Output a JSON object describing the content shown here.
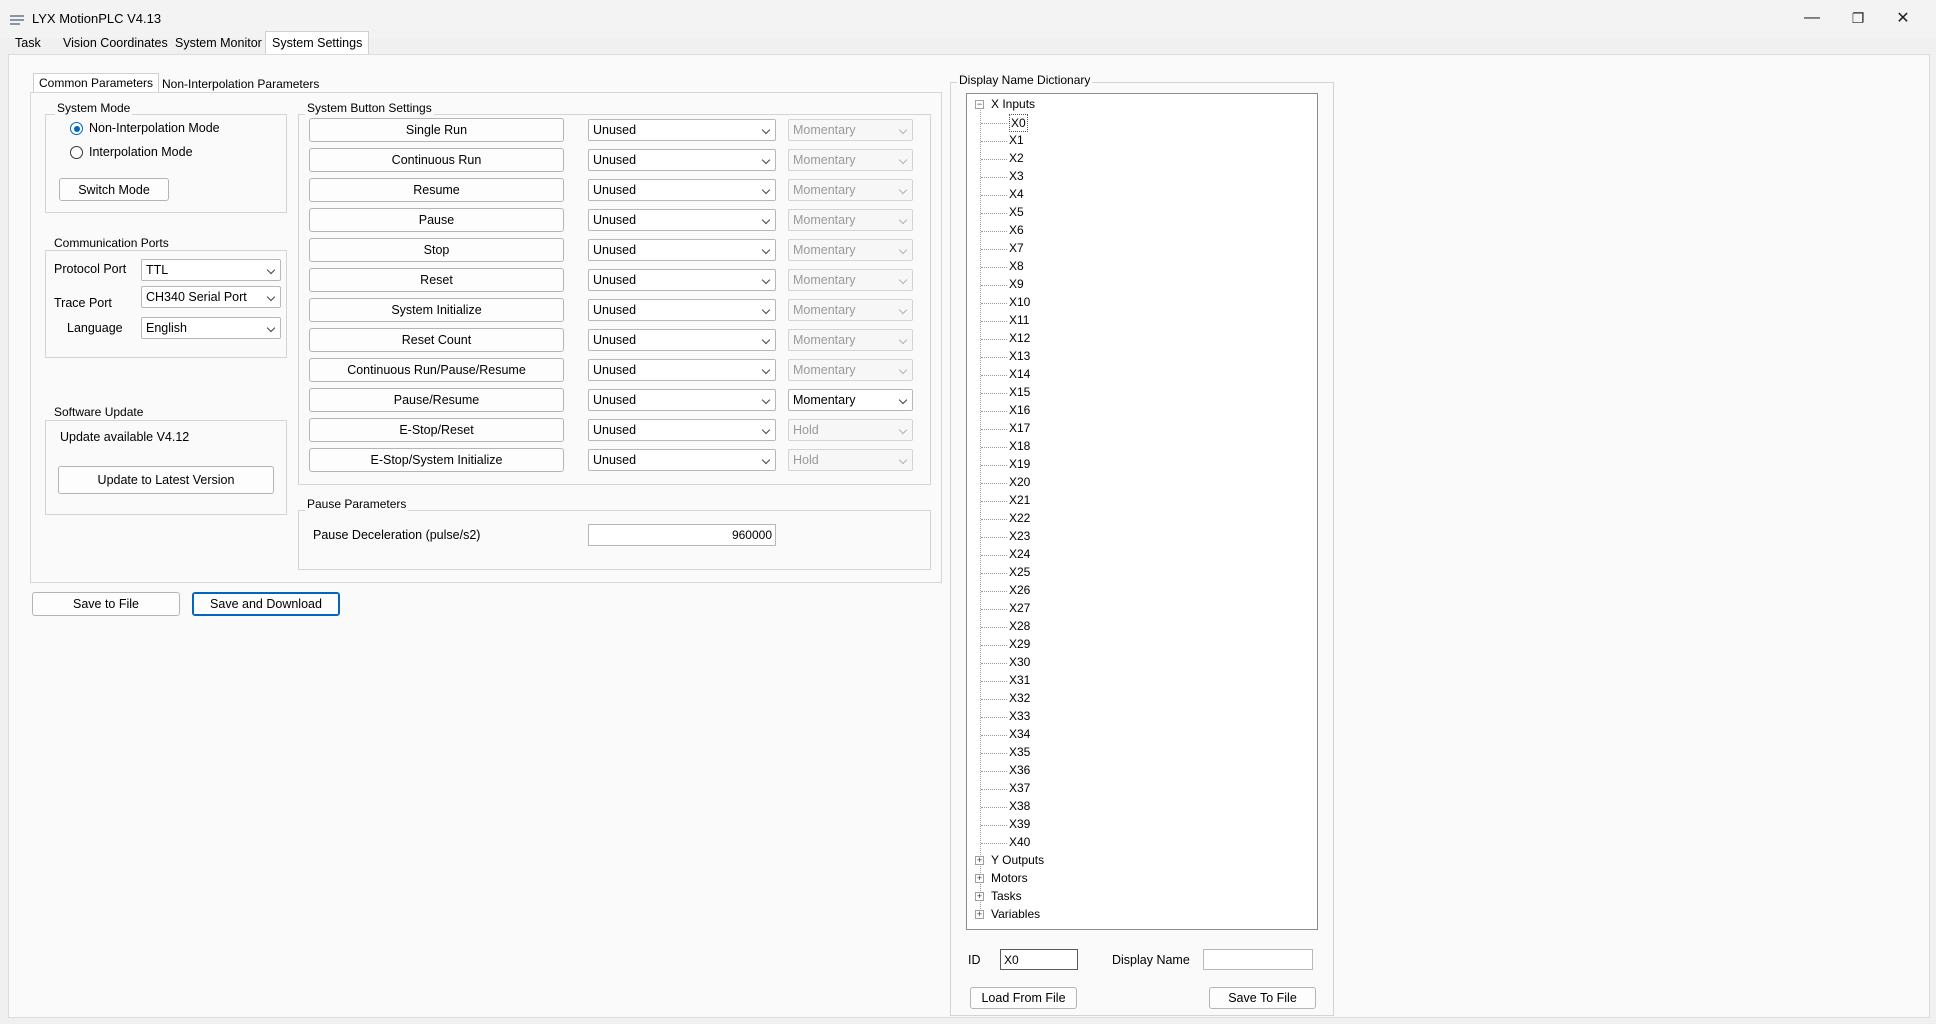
{
  "window": {
    "title": "LYX MotionPLC V4.13",
    "controls": [
      "—",
      "❐",
      "✕"
    ]
  },
  "main_tabs": [
    "Task",
    "Vision Coordinates",
    "System Monitor",
    "System Settings"
  ],
  "sub_tabs": [
    "Common Parameters",
    "Non-Interpolation Parameters"
  ],
  "system_mode": {
    "label": "System Mode",
    "options": [
      "Non-Interpolation Mode",
      "Interpolation Mode"
    ],
    "selected": "Non-Interpolation Mode",
    "switch_label": "Switch Mode"
  },
  "comm": {
    "label": "Communication Ports",
    "rows": [
      {
        "label": "Protocol Port",
        "value": "TTL"
      },
      {
        "label": "Trace Port",
        "value": "CH340 Serial Port"
      },
      {
        "label": "Language",
        "value": "English"
      }
    ]
  },
  "software_update": {
    "label": "Software Update",
    "status": "Update available V4.12",
    "button": "Update to Latest Version"
  },
  "system_buttons": {
    "label": "System Button Settings",
    "rows": [
      {
        "name": "Single Run",
        "assign": "Unused",
        "mode": "Momentary",
        "mode_enabled": false
      },
      {
        "name": "Continuous Run",
        "assign": "Unused",
        "mode": "Momentary",
        "mode_enabled": false
      },
      {
        "name": "Resume",
        "assign": "Unused",
        "mode": "Momentary",
        "mode_enabled": false
      },
      {
        "name": "Pause",
        "assign": "Unused",
        "mode": "Momentary",
        "mode_enabled": false
      },
      {
        "name": "Stop",
        "assign": "Unused",
        "mode": "Momentary",
        "mode_enabled": false
      },
      {
        "name": "Reset",
        "assign": "Unused",
        "mode": "Momentary",
        "mode_enabled": false
      },
      {
        "name": "System Initialize",
        "assign": "Unused",
        "mode": "Momentary",
        "mode_enabled": false
      },
      {
        "name": "Reset Count",
        "assign": "Unused",
        "mode": "Momentary",
        "mode_enabled": false
      },
      {
        "name": "Continuous Run/Pause/Resume",
        "assign": "Unused",
        "mode": "Momentary",
        "mode_enabled": false
      },
      {
        "name": "Pause/Resume",
        "assign": "Unused",
        "mode": "Momentary",
        "mode_enabled": true
      },
      {
        "name": "E-Stop/Reset",
        "assign": "Unused",
        "mode": "Hold",
        "mode_enabled": false
      },
      {
        "name": "E-Stop/System Initialize",
        "assign": "Unused",
        "mode": "Hold",
        "mode_enabled": false
      }
    ]
  },
  "pause_params": {
    "label": "Pause Parameters",
    "decel_label": "Pause Deceleration (pulse/s2)",
    "decel_value": "960000"
  },
  "actions": {
    "save_file": "Save to File",
    "save_download": "Save and Download"
  },
  "dictionary": {
    "label": "Display Name Dictionary",
    "root_expanded": "X Inputs",
    "x_items": [
      "X0",
      "X1",
      "X2",
      "X3",
      "X4",
      "X5",
      "X6",
      "X7",
      "X8",
      "X9",
      "X10",
      "X11",
      "X12",
      "X13",
      "X14",
      "X15",
      "X16",
      "X17",
      "X18",
      "X19",
      "X20",
      "X21",
      "X22",
      "X23",
      "X24",
      "X25",
      "X26",
      "X27",
      "X28",
      "X29",
      "X30",
      "X31",
      "X32",
      "X33",
      "X34",
      "X35",
      "X36",
      "X37",
      "X38",
      "X39",
      "X40"
    ],
    "selected_item": "X0",
    "collapsed": [
      "Y Outputs",
      "Motors",
      "Tasks",
      "Variables"
    ],
    "id_label": "ID",
    "id_value": "X0",
    "display_name_label": "Display Name",
    "display_name_value": "",
    "load_button": "Load From File",
    "save_button": "Save To File"
  }
}
